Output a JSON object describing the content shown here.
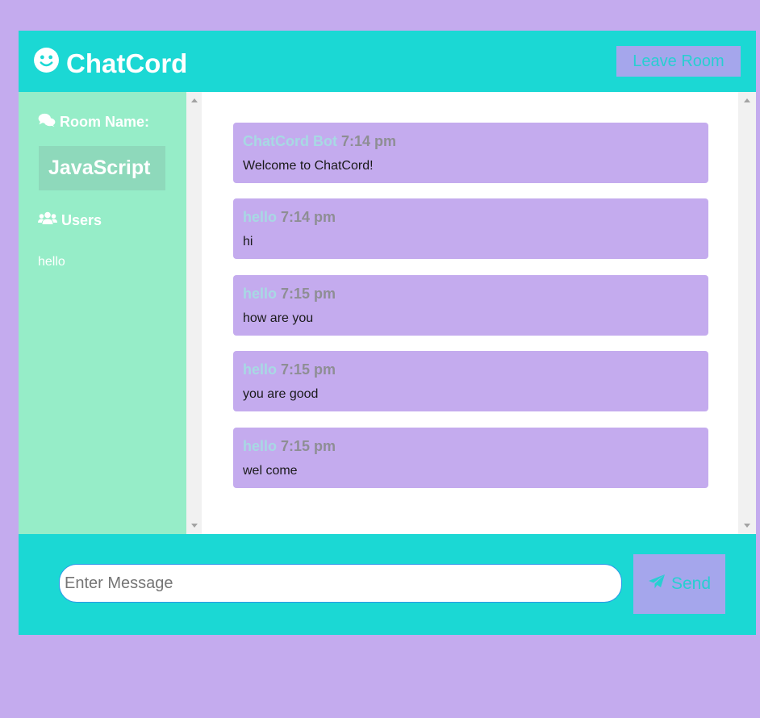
{
  "header": {
    "title": "ChatCord",
    "logo_icon": "smile-icon",
    "leave_label": "Leave Room"
  },
  "sidebar": {
    "room_heading": "Room Name:",
    "room_icon": "comments-icon",
    "room_name": "JavaScript",
    "users_heading": "Users",
    "users_icon": "users-icon",
    "users": [
      "hello"
    ]
  },
  "messages": [
    {
      "user": "ChatCord Bot",
      "time": "7:14 pm",
      "text": "Welcome to ChatCord!"
    },
    {
      "user": "hello",
      "time": "7:14 pm",
      "text": "hi"
    },
    {
      "user": "hello",
      "time": "7:15 pm",
      "text": "how are you"
    },
    {
      "user": "hello",
      "time": "7:15 pm",
      "text": "you are good"
    },
    {
      "user": "hello",
      "time": "7:15 pm",
      "text": "wel come"
    }
  ],
  "form": {
    "placeholder": "Enter Message",
    "value": "",
    "send_label": "Send",
    "send_icon": "paper-plane-icon"
  },
  "colors": {
    "page_bg": "#c4abee",
    "header_bg": "#1bd8d4",
    "sidebar_bg": "#96edc8",
    "message_bg": "#c4abee",
    "button_bg": "#a5a6ec",
    "button_text": "#27cfd1"
  }
}
